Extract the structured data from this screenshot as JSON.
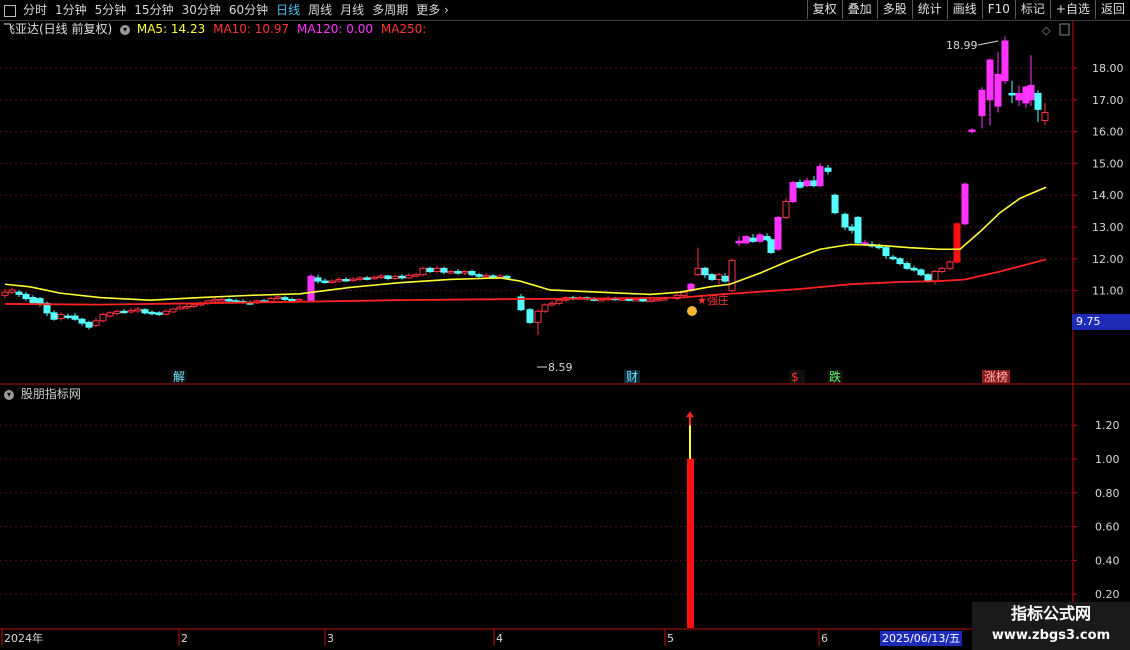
{
  "toolbar": {
    "periods": [
      "分时",
      "1分钟",
      "5分钟",
      "15分钟",
      "30分钟",
      "60分钟",
      "日线",
      "周线",
      "月线",
      "多周期",
      "更多"
    ],
    "active_period": "日线",
    "buttons": [
      "复权",
      "叠加",
      "多股",
      "统计",
      "画线",
      "F10",
      "标记",
      "+自选",
      "返回"
    ]
  },
  "main_header": {
    "title": "飞亚达(日线 前复权)",
    "ma5": "MA5: 14.23",
    "ma10": "MA10: 10.97",
    "ma120": "MA120: 0.00",
    "ma250": "MA250:"
  },
  "sub_header": {
    "title": "股朋指标网"
  },
  "price_axis_labels": [
    "18.00",
    "17.00",
    "16.00",
    "15.00",
    "14.00",
    "13.00",
    "12.00",
    "11.00"
  ],
  "indicator_axis_labels": [
    "1.20",
    "1.00",
    "0.80",
    "0.60",
    "0.40",
    "0.20"
  ],
  "date_axis_labels": [
    "2024年",
    "2",
    "3",
    "4",
    "5",
    "6"
  ],
  "crosshair_price": "9.75",
  "crosshair_date": "2025/06/13/五",
  "annotations": {
    "high": "18.99",
    "low": "8.59",
    "strong": "★强庄",
    "event_markers": [
      "解",
      "财",
      "$",
      "跌",
      "涨榜"
    ]
  },
  "watermark": {
    "line1": "指标公式网",
    "line2": "www.zbgs3.com"
  },
  "colors": {
    "up": "#ff3344",
    "down": "#54ffff",
    "limit_up": "#ff33ff",
    "ma5": "#ffff33",
    "ma10": "#ff2222",
    "ma120": "#ff33ff",
    "signal": "#ff1111"
  },
  "chart_data": [
    {
      "type": "candlestick",
      "title": "飞亚达(日线 前复权)",
      "x_range": [
        "2024-01",
        "2024-06"
      ],
      "y_range": [
        9.6,
        18.99
      ],
      "annotated_high": 18.99,
      "annotated_low": 8.59,
      "series": [
        {
          "name": "MA5",
          "last_value": 14.23
        },
        {
          "name": "MA10",
          "last_value": 10.97
        },
        {
          "name": "MA120",
          "last_value": 0.0
        },
        {
          "name": "MA250"
        }
      ]
    },
    {
      "type": "bar",
      "title": "股朋指标网",
      "ylim": [
        0,
        1.3
      ],
      "series": [
        {
          "name": "signal",
          "values": [
            1.0
          ],
          "marker_top": 1.2,
          "position": "2024-05 start"
        }
      ]
    }
  ]
}
